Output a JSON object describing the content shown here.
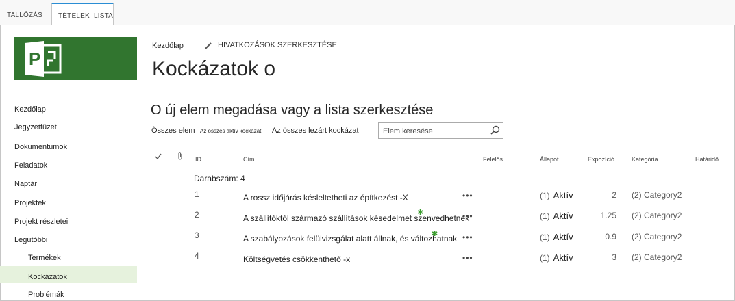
{
  "ribbon": {
    "browse": "TALLÓZÁS",
    "items": "TÉTELEK",
    "list": "LISTA"
  },
  "breadcrumb": {
    "home": "Kezdőlap",
    "edit_links": "HIVATKOZÁSOK SZERKESZTÉSE"
  },
  "page_title": "Kockázatok o",
  "nav": {
    "items": [
      "Kezdőlap",
      "Jegyzetfüzet",
      "Dokumentumok",
      "Feladatok",
      "Naptár",
      "Projektek",
      "Projekt részletei",
      "Legutóbbi"
    ],
    "sub_items": [
      "Termékek",
      "Kockázatok",
      "Problémák"
    ],
    "selected": "Kockázatok"
  },
  "list_title": "O új elem megadása vagy a lista szerkesztése",
  "views": {
    "all": "Összes elem",
    "active": "Az összes aktív kockázat",
    "closed": "Az összes lezárt kockázat"
  },
  "search": {
    "placeholder": "Elem keresése"
  },
  "columns": {
    "id": "ID",
    "title": "Cím",
    "owner": "Felelős",
    "status": "Állapot",
    "exposure": "Expozíció",
    "category": "Kategória",
    "due": "Határidő"
  },
  "group_count": "Darabszám: 4",
  "rows": [
    {
      "id": "1",
      "title": "A rossz időjárás késleltetheti az építkezést -X",
      "status_code": "(1)",
      "status": "Aktív",
      "exposure": "2",
      "category": "(2) Category2"
    },
    {
      "id": "2",
      "title": "A szállítóktól származó szállítások késedelmet szenvedhetnek",
      "status_code": "(1)",
      "status": "Aktív",
      "exposure": "1.25",
      "category": "(2) Category2"
    },
    {
      "id": "3",
      "title": "A szabályozások felülvizsgálat alatt állnak, és változhatnak",
      "status_code": "(1)",
      "status": "Aktív",
      "exposure": "0.9",
      "category": "(2) Category2"
    },
    {
      "id": "4",
      "title": "Költségvetés csökkenthető -x",
      "status_code": "(1)",
      "status": "Aktív",
      "exposure": "3",
      "category": "(2) Category2"
    }
  ],
  "more_glyph": "•••",
  "colors": {
    "brand_green": "#31752f",
    "selected_nav": "#e6f2dd",
    "tab_accent": "#2a8dd4"
  }
}
